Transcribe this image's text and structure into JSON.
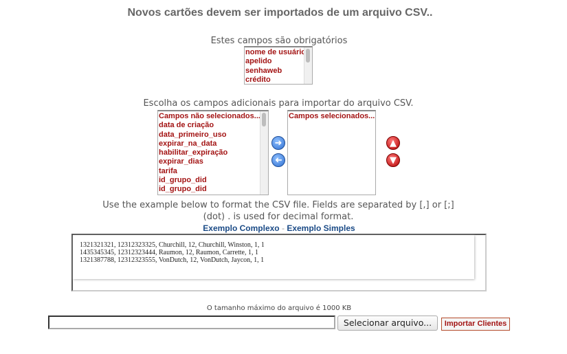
{
  "title": "Novos cartões devem ser importados de um arquivo CSV..",
  "required": {
    "caption": "Estes campos são obrigatórios",
    "items": [
      "nome de usuário",
      "apelido",
      "senhaweb",
      "crédito"
    ]
  },
  "additional": {
    "caption": "Escolha os campos adicionais para importar do arquivo CSV.",
    "available": [
      "Campos não selecionados...",
      "data de criação",
      "data_primeiro_uso",
      "expirar_na_data",
      "habilitar_expiração",
      "expirar_dias",
      "tarifa",
      "id_grupo_did",
      "id_grupo_did"
    ],
    "selected": [
      "Campos selecionados..."
    ]
  },
  "icons": {
    "add": "arrow-right-icon",
    "remove": "arrow-left-icon",
    "up": "arrow-up-icon",
    "down": "arrow-down-icon"
  },
  "format_note": {
    "line1": "Use the example below to format the CSV file. Fields are separated by [,] or [;]",
    "line2": "(dot) . is used for decimal format."
  },
  "examples": {
    "complex": "Exemplo Complexo",
    "separator": "-",
    "simple": "Exemplo Simples",
    "lines": [
      "1321321321, 12312323325, Churchill, 12, Churchill, Winston, 1, 1",
      "1435345345, 12312323444, Raumon, 12, Raumon, Carrette, 1, 1",
      "1321387788, 12312323555, VonDutch, 12, VonDutch, Jaycon, 1, 1"
    ]
  },
  "upload": {
    "max_size": "O tamanho máximo do arquivo é 1000 KB",
    "file_value": "",
    "select_label": "Selecionar arquivo...",
    "import_label": "Importar Clientes"
  },
  "colors": {
    "option_text": "#a31414",
    "link": "#1a4a86",
    "button_blue": "#2f6fd0",
    "button_red": "#b30000"
  }
}
